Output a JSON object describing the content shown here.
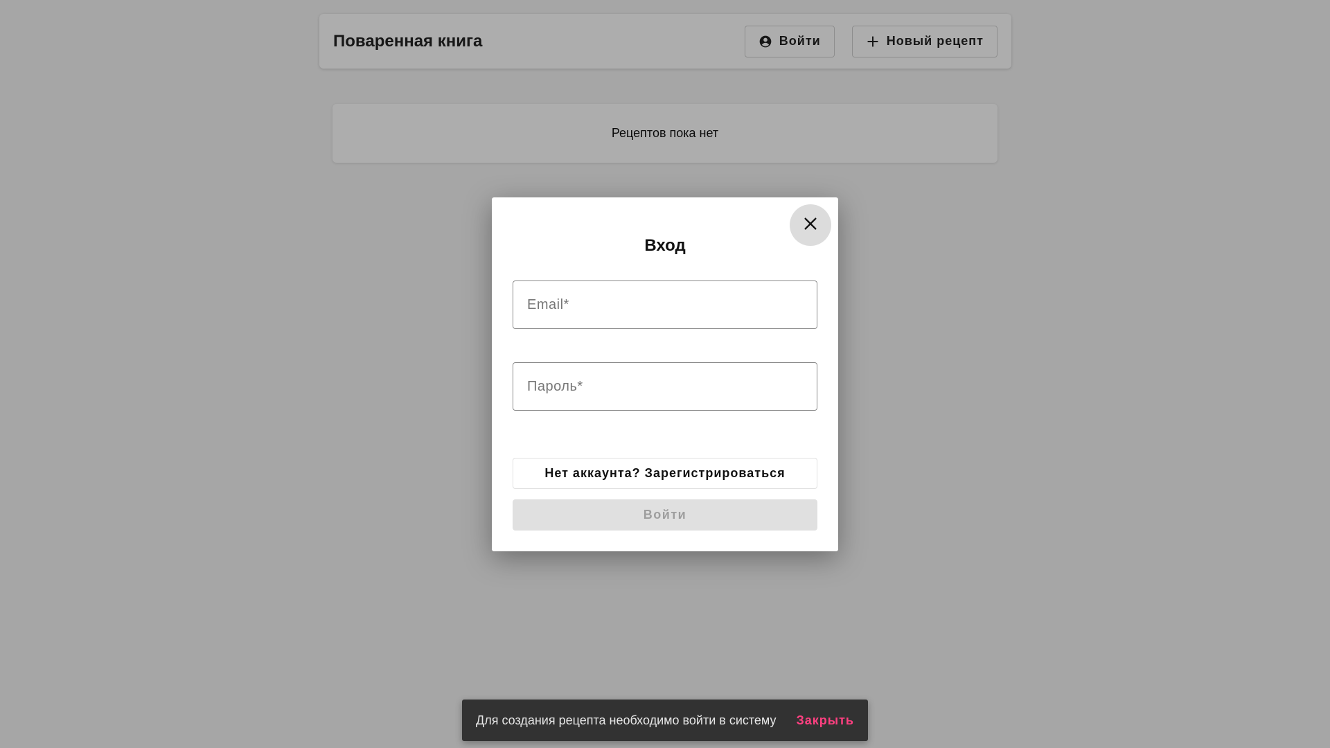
{
  "header": {
    "title": "Поваренная книга",
    "login_label": "Войти",
    "login_icon": "account-circle-icon",
    "new_recipe_label": "Новый рецепт",
    "new_recipe_icon": "plus-icon"
  },
  "recipes": {
    "empty_message": "Рецептов пока нет"
  },
  "login_dialog": {
    "title": "Вход",
    "close_icon": "close-icon",
    "email_placeholder": "Email*",
    "email_value": "",
    "password_placeholder": "Пароль*",
    "password_value": "",
    "register_label": "Нет аккаунта? Зарегистрироваться",
    "submit_label": "Войти",
    "submit_disabled": true
  },
  "snackbar": {
    "message": "Для создания рецепта необходимо войти в систему",
    "action_label": "Закрыть"
  },
  "colors": {
    "snackbar_action": "#ff4081",
    "backdrop": "rgba(0,0,0,0.32)"
  }
}
